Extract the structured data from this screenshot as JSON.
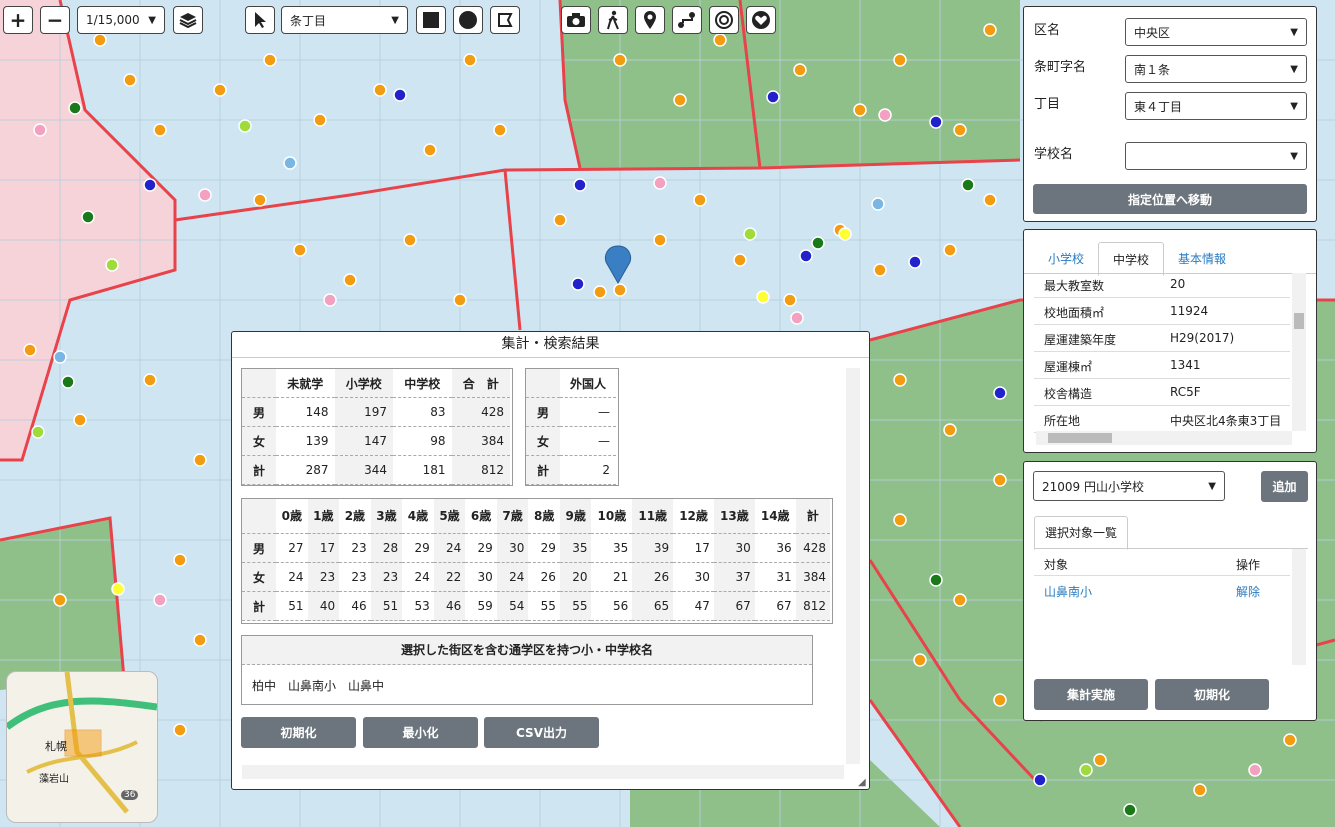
{
  "toolbar": {
    "zoom_in": "+",
    "zoom_out": "−",
    "scale": "1/15,000",
    "select_mode": "条丁目"
  },
  "search": {
    "ward_label": "区名",
    "ward_value": "中央区",
    "town_label": "条町字名",
    "town_value": "南１条",
    "chome_label": "丁目",
    "chome_value": "東４丁目",
    "school_label": "学校名",
    "school_value": "",
    "move_button": "指定位置へ移動"
  },
  "info": {
    "tabs": [
      "小学校",
      "中学校",
      "基本情報"
    ],
    "active_tab": 1,
    "rows": [
      {
        "key": "最大教室数",
        "value": "20"
      },
      {
        "key": "校地面積㎡",
        "value": "11924"
      },
      {
        "key": "屋運建築年度",
        "value": "H29(2017)"
      },
      {
        "key": "屋運棟㎡",
        "value": "1341"
      },
      {
        "key": "校舎構造",
        "value": "RC5F"
      },
      {
        "key": "所在地",
        "value": "中央区北4条東3丁目"
      }
    ]
  },
  "selection": {
    "school_select": "21009 円山小学校",
    "add_button": "追加",
    "list_tab": "選択対象一覧",
    "col_target": "対象",
    "col_action": "操作",
    "items": [
      {
        "target": "山鼻南小",
        "action": "解除"
      }
    ],
    "run_button": "集計実施",
    "reset_button": "初期化"
  },
  "results": {
    "title": "集計・検索結果",
    "summary_headers": [
      "",
      "未就学",
      "小学校",
      "中学校",
      "合　計"
    ],
    "summary_rows": [
      [
        "男",
        "148",
        "197",
        "83",
        "428"
      ],
      [
        "女",
        "139",
        "147",
        "98",
        "384"
      ],
      [
        "計",
        "287",
        "344",
        "181",
        "812"
      ]
    ],
    "foreign_header": "外国人",
    "foreign_rows": [
      [
        "男",
        "—"
      ],
      [
        "女",
        "—"
      ],
      [
        "計",
        "2"
      ]
    ],
    "age_headers": [
      "0歳",
      "1歳",
      "2歳",
      "3歳",
      "4歳",
      "5歳",
      "6歳",
      "7歳",
      "8歳",
      "9歳",
      "10歳",
      "11歳",
      "12歳",
      "13歳",
      "14歳",
      "計"
    ],
    "age_rows": [
      {
        "label": "男",
        "values": [
          "27",
          "17",
          "23",
          "28",
          "29",
          "24",
          "29",
          "30",
          "29",
          "35",
          "35",
          "39",
          "17",
          "30",
          "36",
          "428"
        ]
      },
      {
        "label": "女",
        "values": [
          "24",
          "23",
          "23",
          "23",
          "24",
          "22",
          "30",
          "24",
          "26",
          "20",
          "21",
          "26",
          "30",
          "37",
          "31",
          "384"
        ]
      },
      {
        "label": "計",
        "values": [
          "51",
          "40",
          "46",
          "51",
          "53",
          "46",
          "59",
          "54",
          "55",
          "55",
          "56",
          "65",
          "47",
          "67",
          "67",
          "812"
        ]
      }
    ],
    "schools_header": "選択した街区を含む通学区を持つ小・中学校名",
    "schools_value": "柏中　山鼻南小　山鼻中",
    "buttons": [
      "初期化",
      "最小化",
      "CSV出力"
    ]
  },
  "minimap": {
    "labels": [
      "札幌",
      "藻岩山",
      "36"
    ]
  },
  "colors": {
    "map_blue": "#cfe6f2",
    "map_green": "#8fc08a",
    "map_pink": "#f6d3d8",
    "boundary": "#e8424a",
    "button_gray": "#6c757d"
  }
}
